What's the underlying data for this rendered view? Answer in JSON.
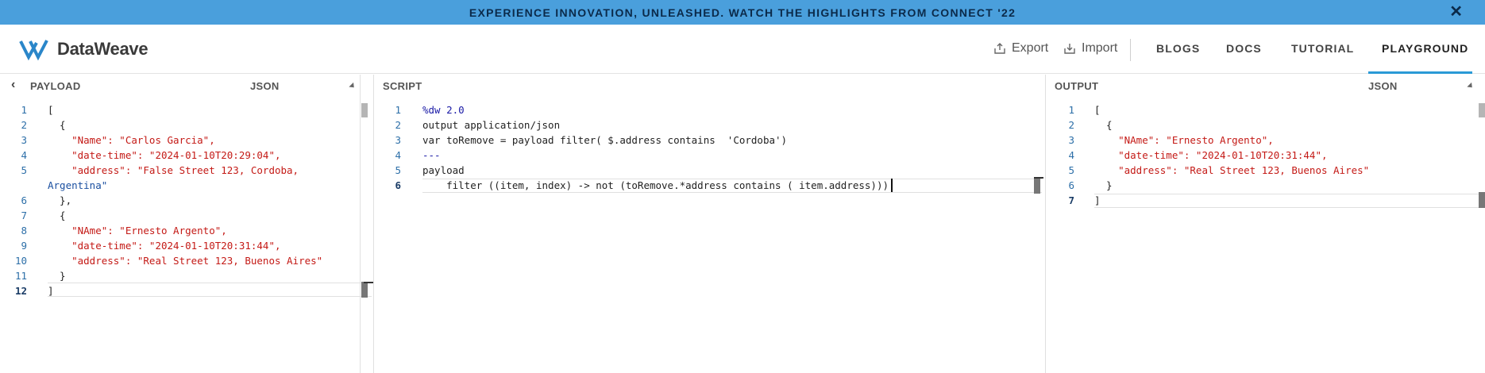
{
  "banner": {
    "text": "EXPERIENCE INNOVATION, UNLEASHED. WATCH THE HIGHLIGHTS FROM CONNECT '22",
    "close": "✕"
  },
  "header": {
    "logo_text": "DataWeave",
    "export_label": "Export",
    "import_label": "Import",
    "nav": [
      "BLOGS",
      "DOCS",
      "TUTORIAL",
      "PLAYGROUND"
    ],
    "active_nav": "PLAYGROUND",
    "accent_color": "#2a9ad6"
  },
  "payload": {
    "title": "PAYLOAD",
    "format": "JSON",
    "collapse_icon": "chevron-left-icon",
    "line_numbers": [
      "1",
      "2",
      "3",
      "4",
      "5",
      "6",
      "7",
      "8",
      "9",
      "10",
      "11",
      "12"
    ],
    "lines": [
      "[",
      "  {",
      "    \"Name\": \"Carlos Garcia\",",
      "    \"date-time\": \"2024-01-10T20:29:04\",",
      "    \"address\": \"False Street 123, Cordoba,",
      "Argentina\"",
      "  },",
      "  {",
      "    \"NAme\": \"Ernesto Argento\",",
      "    \"date-time\": \"2024-01-10T20:31:44\",",
      "    \"address\": \"Real Street 123, Buenos Aires\"",
      "  }",
      "]"
    ]
  },
  "script": {
    "title": "SCRIPT",
    "line_numbers": [
      "1",
      "2",
      "3",
      "4",
      "5",
      "6"
    ],
    "lines": [
      "%dw 2.0",
      "output application/json",
      "var toRemove = payload filter( $.address contains  'Cordoba')",
      "---",
      "payload",
      "    filter ((item, index) -> not (toRemove.*address contains ( item.address)))"
    ]
  },
  "output": {
    "title": "OUTPUT",
    "format": "JSON",
    "line_numbers": [
      "1",
      "2",
      "3",
      "4",
      "5",
      "6",
      "7"
    ],
    "lines": [
      "[",
      "  {",
      "    \"NAme\": \"Ernesto Argento\",",
      "    \"date-time\": \"2024-01-10T20:31:44\",",
      "    \"address\": \"Real Street 123, Buenos Aires\"",
      "  }",
      "]"
    ]
  }
}
